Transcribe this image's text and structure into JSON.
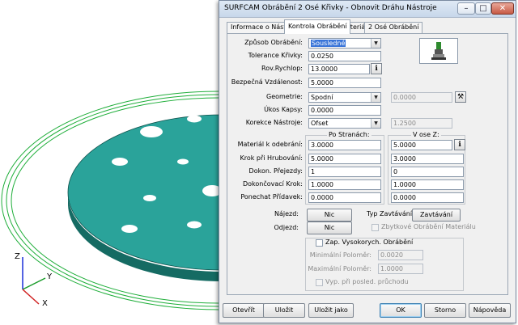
{
  "dialog": {
    "title": "SURFCAM Obrábění 2 Osé Křivky - Obnovit Dráhu Nástroje",
    "window_controls": {
      "minimize": "–",
      "maximize": "□",
      "close": "✕"
    }
  },
  "tabs": [
    {
      "label": "Informace o Nástroji"
    },
    {
      "label": "Kontrola Obrábění"
    },
    {
      "label": "Materiál"
    },
    {
      "label": "2 Osé Obrábění"
    }
  ],
  "active_tab": "Kontrola Obrábění",
  "params": {
    "zpusob_label": "Způsob Obrábění:",
    "zpusob_value": "Sousledné",
    "tolerance_label": "Tolerance Křivky:",
    "tolerance_value": "0.0250",
    "rov_label": "Rov.Rychlop:",
    "rov_value": "13.0000",
    "bezp_label": "Bezpečná Vzdálenost:",
    "bezp_value": "5.0000",
    "geometrie_label": "Geometrie:",
    "geometrie_value": "Spodní",
    "geometrie_extra": "0.0000",
    "ukos_label": "Úkos Kapsy:",
    "ukos_value": "0.0000",
    "korekce_label": "Korekce Nástroje:",
    "korekce_value": "Ofset",
    "korekce_extra": "1.2500"
  },
  "passes": {
    "po_stranach_title": "Po Stranách:",
    "v_ose_z_title": "V ose Z:",
    "rows": [
      {
        "label": "Materiál k odebrání:",
        "side": "3.0000",
        "z": "5.0000"
      },
      {
        "label": "Krok při Hrubování:",
        "side": "5.0000",
        "z": "3.0000"
      },
      {
        "label": "Dokon. Přejezdy:",
        "side": "1",
        "z": "0"
      },
      {
        "label": "Dokončovací Krok:",
        "side": "1.0000",
        "z": "1.0000"
      },
      {
        "label": "Ponechat Přídavek:",
        "side": "0.0000",
        "z": "0.0000"
      }
    ]
  },
  "leads": {
    "najezd_label": "Nájezd:",
    "najezd_button": "Nic",
    "odjezd_label": "Odjezd:",
    "odjezd_button": "Nic",
    "typ_label": "Typ Zavtávání:",
    "typ_button": "Zavtávání",
    "zbytkove_label": "Zbytkové Obrábění Materiálu"
  },
  "hsm": {
    "enable_label": "Zap. Vysokorych. Obrábění",
    "min_label": "Minimální Poloměr:",
    "min_value": "0.0020",
    "max_label": "Maximální Poloměr:",
    "max_value": "1.0000",
    "vyp_label": "Vyp. při posled. průchodu"
  },
  "footer": {
    "otevrit": "Otevřít",
    "ulozit": "Uložit",
    "ulozit_jako": "Uložit jako",
    "ok": "OK",
    "storno": "Storno",
    "napoveda": "Nápověda"
  },
  "axes": {
    "z": "Z",
    "y": "Y",
    "x": "X"
  },
  "colors": {
    "part_fill": "#1f8a80",
    "part_top": "#2aa39a",
    "wire_green": "#1fae3a",
    "selection": "#3874d8"
  }
}
